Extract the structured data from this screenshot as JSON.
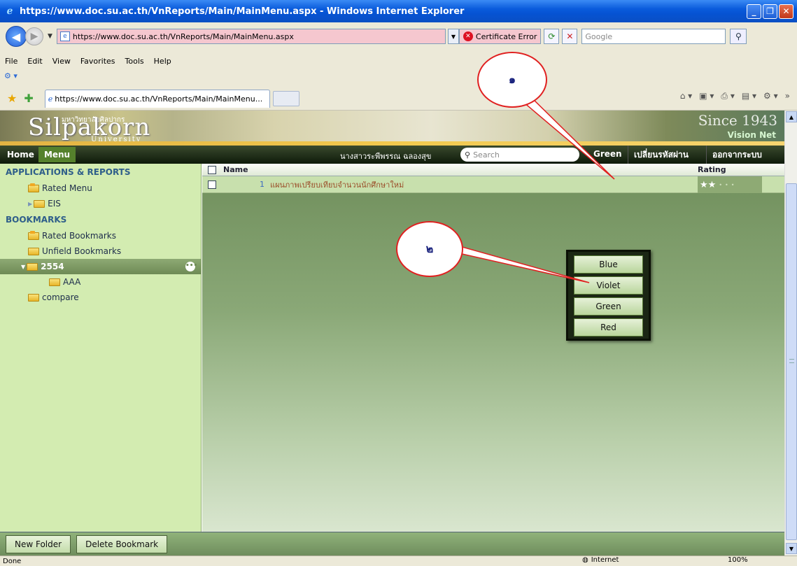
{
  "window": {
    "title": "https://www.doc.su.ac.th/VnReports/Main/MainMenu.aspx - Windows Internet Explorer"
  },
  "address_bar": {
    "url": "https://www.doc.su.ac.th/VnReports/Main/MainMenu.aspx",
    "cert_error": "Certificate Error",
    "search_placeholder": "Google"
  },
  "menubar": {
    "items": [
      "File",
      "Edit",
      "View",
      "Favorites",
      "Tools",
      "Help"
    ]
  },
  "tabs": {
    "active_label": "https://www.doc.su.ac.th/VnReports/Main/MainMenu..."
  },
  "banner": {
    "logo": "Silpakorn",
    "logo_thai": "มหาวิทยาลัยศิลปากร",
    "logo_sub": "University",
    "since": "Since 1943",
    "vendor": "Vision Net"
  },
  "navbar": {
    "home": "Home",
    "menu": "Menu",
    "user": "นางสาวระพีพรรณ ฉลองสุข",
    "search_placeholder": "Search",
    "theme": "Green",
    "change_password": "เปลี่ยนรหัสผ่าน",
    "logout": "ออกจากระบบ"
  },
  "sidebar": {
    "apps_heading": "APPLICATIONS & REPORTS",
    "rated_menu": "Rated Menu",
    "eis": "EIS",
    "bookmarks_heading": "BOOKMARKS",
    "rated_bookmarks": "Rated Bookmarks",
    "unfield_bookmarks": "Unfield Bookmarks",
    "folder_2554": "2554",
    "folder_aaa": "AAA",
    "folder_compare": "compare"
  },
  "list": {
    "col_name": "Name",
    "col_rating": "Rating",
    "rows": [
      {
        "num": "1",
        "name": "แผนภาพเปรียบเทียบจำนวนนักศึกษาใหม่",
        "rating": 2,
        "rating_max": 5
      }
    ]
  },
  "footer": {
    "new_folder": "New Folder",
    "delete_bookmark": "Delete Bookmark"
  },
  "color_popup": {
    "options": [
      "Blue",
      "Violet",
      "Green",
      "Red"
    ]
  },
  "callouts": {
    "one": "๑",
    "two": "๒"
  },
  "statusbar": {
    "status": "Done",
    "zone": "Internet",
    "zoom": "100%"
  }
}
